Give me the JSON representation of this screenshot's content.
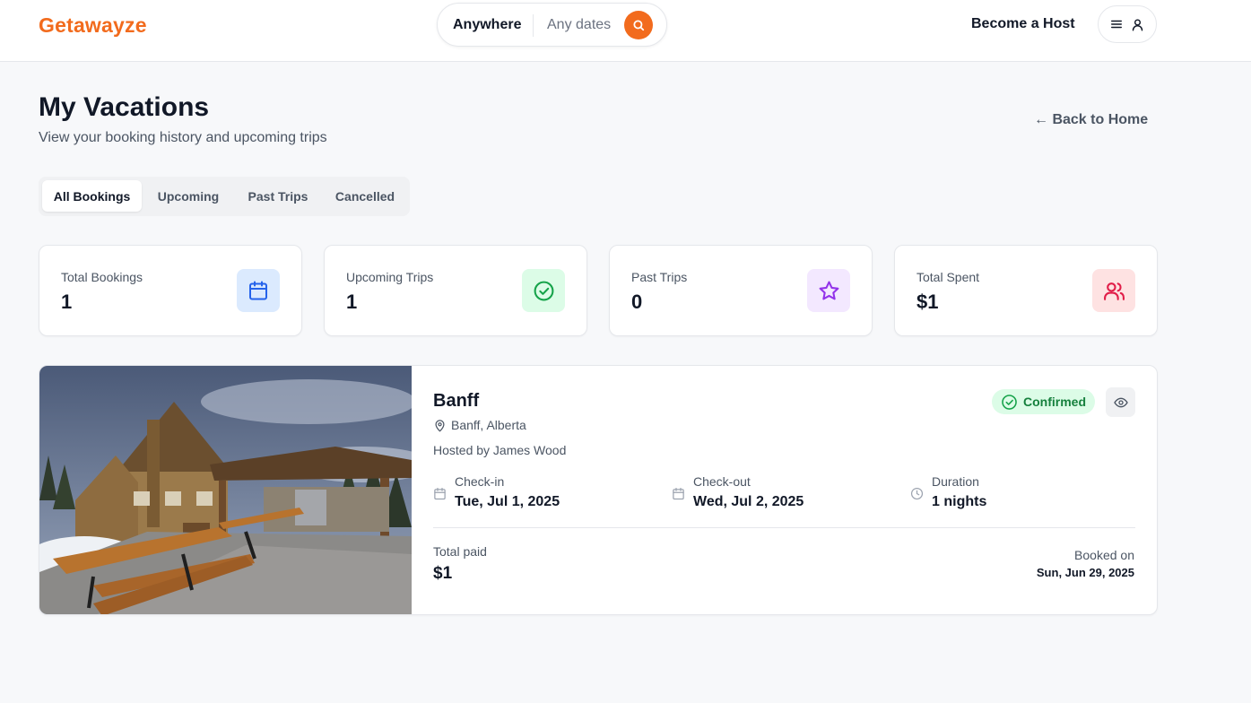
{
  "header": {
    "logo": "Getawayze",
    "search": {
      "where": "Anywhere",
      "dates": "Any dates",
      "icon": "search-icon"
    },
    "become_host": "Become a Host",
    "user_menu": {
      "icons": [
        "menu-icon",
        "user-icon"
      ]
    }
  },
  "page": {
    "title": "My Vacations",
    "subtitle": "View your booking history and upcoming trips",
    "back_link": "← Back to Home"
  },
  "tabs": [
    {
      "label": "All Bookings",
      "active": true
    },
    {
      "label": "Upcoming",
      "active": false
    },
    {
      "label": "Past Trips",
      "active": false
    },
    {
      "label": "Cancelled",
      "active": false
    }
  ],
  "stats": [
    {
      "label": "Total Bookings",
      "value": "1",
      "icon": "calendar-icon",
      "bg": "#dbeafe",
      "color": "#2563eb"
    },
    {
      "label": "Upcoming Trips",
      "value": "1",
      "icon": "check-circle-icon",
      "bg": "#dcfce7",
      "color": "#16a34a"
    },
    {
      "label": "Past Trips",
      "value": "0",
      "icon": "star-icon",
      "bg": "#f3e8ff",
      "color": "#9333ea"
    },
    {
      "label": "Total Spent",
      "value": "$1",
      "icon": "users-icon",
      "bg": "#fee2e2",
      "color": "#e11d48"
    }
  ],
  "booking": {
    "title": "Banff",
    "location": "Banff, Alberta",
    "hosted_by": "Hosted by James Wood",
    "status": "Confirmed",
    "checkin_label": "Check-in",
    "checkin_value": "Tue, Jul 1, 2025",
    "checkout_label": "Check-out",
    "checkout_value": "Wed, Jul 2, 2025",
    "duration_label": "Duration",
    "duration_value": "1 nights",
    "paid_label": "Total paid",
    "paid_value": "$1",
    "booked_label": "Booked on",
    "booked_value": "Sun, Jun 29, 2025"
  },
  "colors": {
    "brand": "#f26b1d",
    "confirmed_bg": "#dcfce7",
    "confirmed_text": "#15803d"
  }
}
